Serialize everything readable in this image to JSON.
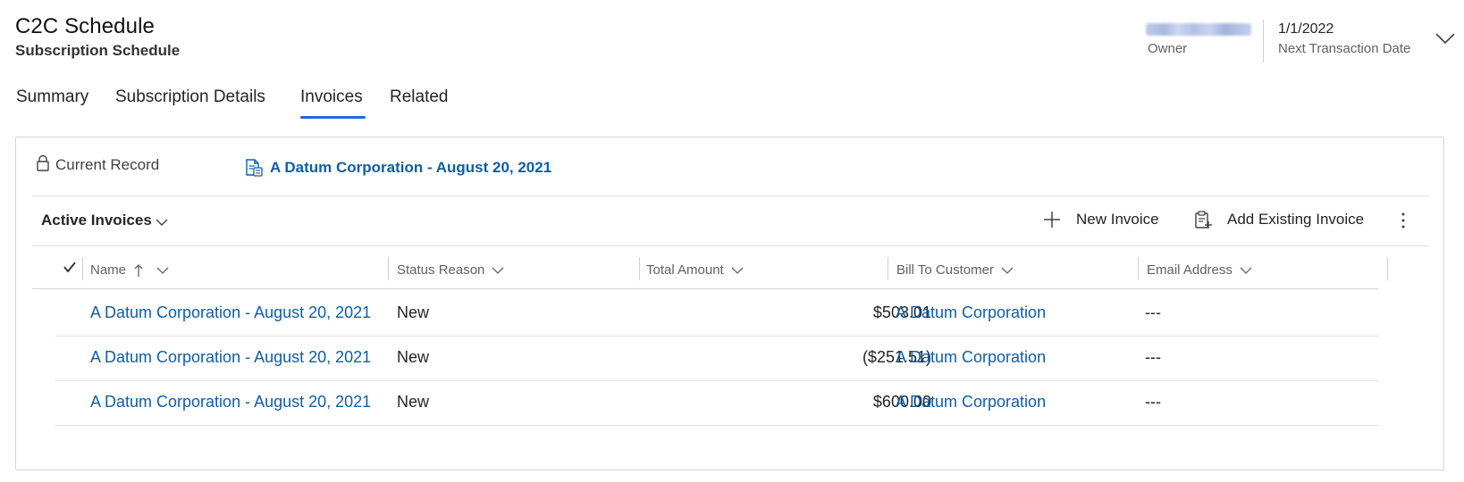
{
  "header": {
    "title": "C2C Schedule",
    "subtitle": "Subscription Schedule",
    "owner_label": "Owner",
    "next_date_value": "1/1/2022",
    "next_date_label": "Next Transaction Date"
  },
  "tabs": [
    {
      "label": "Summary"
    },
    {
      "label": "Subscription Details"
    },
    {
      "label": "Invoices",
      "active": true
    },
    {
      "label": "Related"
    }
  ],
  "panel": {
    "current_record_label": "Current Record",
    "record_link": "A Datum Corporation - August 20, 2021",
    "view_title": "Active Invoices",
    "commands": {
      "new_invoice": "New Invoice",
      "add_existing_invoice": "Add Existing Invoice"
    }
  },
  "grid": {
    "columns": [
      "Name",
      "Status Reason",
      "Total Amount",
      "Bill To Customer",
      "Email Address"
    ],
    "rows": [
      {
        "name": "A Datum Corporation - August 20, 2021",
        "status": "New",
        "amount": "$503.01",
        "customer": "A Datum Corporation",
        "email": "---"
      },
      {
        "name": "A Datum Corporation - August 20, 2021",
        "status": "New",
        "amount": "($251.51)",
        "customer": "A Datum Corporation",
        "email": "---"
      },
      {
        "name": "A Datum Corporation - August 20, 2021",
        "status": "New",
        "amount": "$600.00",
        "customer": "A Datum Corporation",
        "email": "---"
      }
    ]
  },
  "colors": {
    "accent": "#2266e3",
    "link": "#115ea3"
  }
}
